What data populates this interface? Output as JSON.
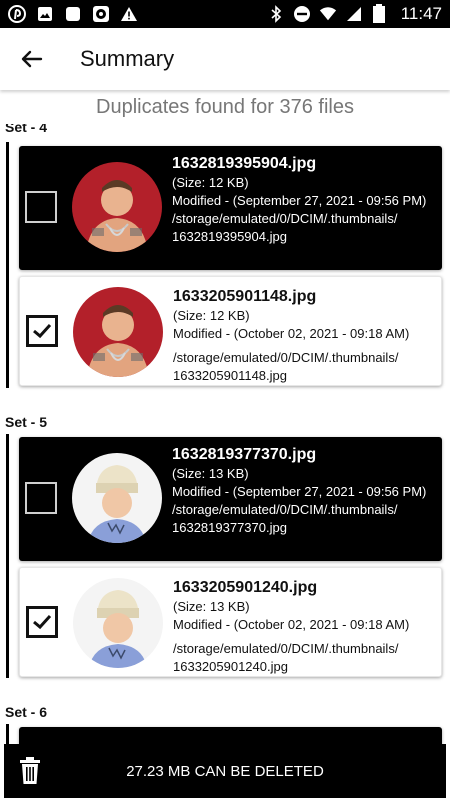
{
  "status_bar": {
    "time": "11:47",
    "battery_level": "86",
    "left_icons": [
      "pinterest-icon",
      "image-icon",
      "square-app-icon",
      "soccer-ball-icon",
      "warning-icon"
    ],
    "right_icons": [
      "bluetooth-icon",
      "do-not-disturb-icon",
      "wifi-icon",
      "cellular-signal-icon",
      "battery-icon"
    ]
  },
  "app_bar": {
    "title": "Summary"
  },
  "summary_line": "Duplicates found for 376 files",
  "sets": [
    {
      "label": "Set - 4",
      "files": [
        {
          "name": "1632819395904.jpg",
          "size": "(Size: 12 KB)",
          "modified": "Modified - (September 27, 2021 - 09:56 PM)",
          "path": "/storage/emulated/0/DCIM/.thumbnails/ 1632819395904.jpg",
          "selected": false
        },
        {
          "name": "1633205901148.jpg",
          "size": "(Size: 12 KB)",
          "modified": "Modified - (October 02, 2021 - 09:18 AM)",
          "path": "/storage/emulated/0/DCIM/.thumbnails/ 1633205901148.jpg",
          "selected": true
        }
      ]
    },
    {
      "label": "Set - 5",
      "files": [
        {
          "name": "1632819377370.jpg",
          "size": "(Size: 13 KB)",
          "modified": "Modified - (September 27, 2021 - 09:56 PM)",
          "path": "/storage/emulated/0/DCIM/.thumbnails/ 1632819377370.jpg",
          "selected": false
        },
        {
          "name": "1633205901240.jpg",
          "size": "(Size: 13 KB)",
          "modified": "Modified - (October 02, 2021 - 09:18 AM)",
          "path": "/storage/emulated/0/DCIM/.thumbnails/ 1633205901240.jpg",
          "selected": true
        }
      ]
    },
    {
      "label": "Set - 6",
      "files": []
    }
  ],
  "bottom_bar": {
    "label": "27.23 MB CAN BE DELETED",
    "icon": "trash-icon"
  },
  "colors": {
    "selected_card_bg": "#000000",
    "unselected_card_bg": "#ffffff",
    "text_primary": "#111111",
    "text_secondary": "#777777"
  }
}
